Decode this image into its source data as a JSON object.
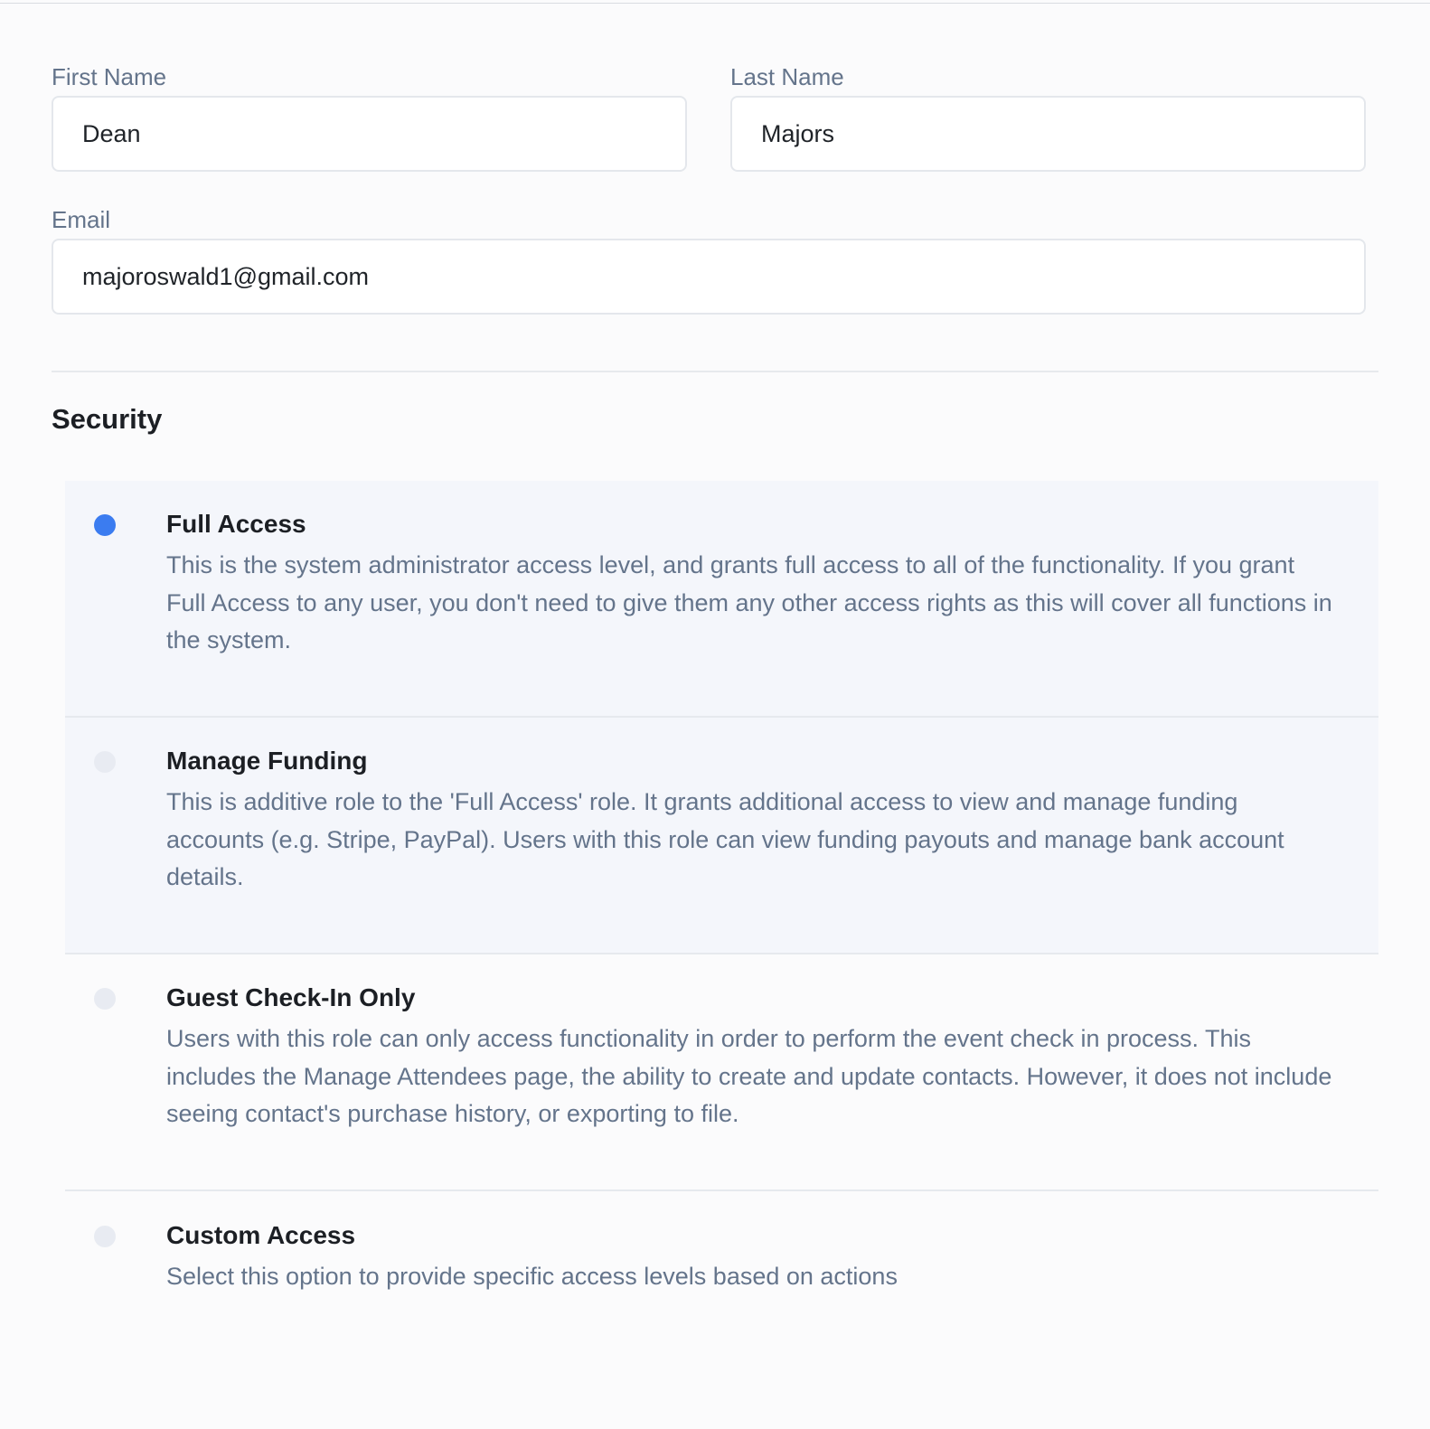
{
  "form": {
    "first_name": {
      "label": "First Name",
      "value": "Dean"
    },
    "last_name": {
      "label": "Last Name",
      "value": "Majors"
    },
    "email": {
      "label": "Email",
      "value": "majoroswald1@gmail.com"
    }
  },
  "security": {
    "title": "Security",
    "selected": "full-access",
    "options": [
      {
        "id": "full-access",
        "title": "Full Access",
        "description": "This is the system administrator access level, and grants full access to all of the functionality. If you grant Full Access to any user, you don't need to give them any other access rights as this will cover all functions in the system."
      },
      {
        "id": "manage-funding",
        "title": "Manage Funding",
        "description": "This is additive role to the 'Full Access' role. It grants additional access to view and manage funding accounts (e.g. Stripe, PayPal). Users with this role can view funding payouts and manage bank account details."
      },
      {
        "id": "guest-check-in-only",
        "title": "Guest Check-In Only",
        "description": "Users with this role can only access functionality in order to perform the event check in process. This includes the Manage Attendees page, the ability to create and update contacts. However, it does not include seeing contact's purchase history, or exporting to file."
      },
      {
        "id": "custom-access",
        "title": "Custom Access",
        "description": "Select this option to provide specific access levels based on actions"
      }
    ]
  },
  "colors": {
    "radio_selected": "#3b7cf0",
    "radio_unselected": "#e8ebf2",
    "option_shaded_bg": "#f4f6fb",
    "label_text": "#64748b"
  }
}
